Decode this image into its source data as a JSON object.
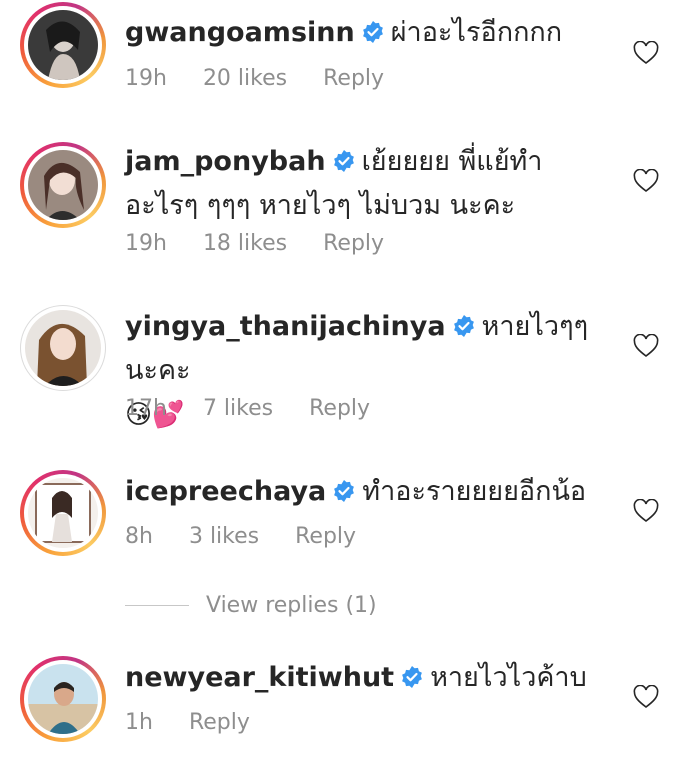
{
  "comments": [
    {
      "username": "gwangoamsinn",
      "text": "ผ่าอะไรอีกกกก",
      "time": "19h",
      "likes": "20 likes",
      "reply": "Reply"
    },
    {
      "username": "jam_ponybah",
      "text": "เย้ยยยย พี่แย้ทำอะไรๆ ๆๆๆ  หายไวๆ ไม่บวม นะคะ",
      "time": "19h",
      "likes": "18 likes",
      "reply": "Reply"
    },
    {
      "username": "yingya_thanijachinya",
      "text": "หายไวๆๆนะคะ",
      "emoji": "😘💕",
      "time": "17h",
      "likes": "7 likes",
      "reply": "Reply"
    },
    {
      "username": "icepreechaya",
      "text": "ทำอะรายยยยอีกน้อ",
      "time": "8h",
      "likes": "3 likes",
      "reply": "Reply",
      "view_replies": "View replies (1)"
    },
    {
      "username": "newyear_kitiwhut",
      "text": "หายไวไวค้าบ",
      "time": "1h",
      "reply": "Reply"
    }
  ],
  "colors": {
    "verified_blue": "#3897f0",
    "meta_gray": "#8e8e8e",
    "text_dark": "#262626"
  },
  "icons": {
    "verified": "verified-badge-icon",
    "like": "heart-outline-icon"
  }
}
